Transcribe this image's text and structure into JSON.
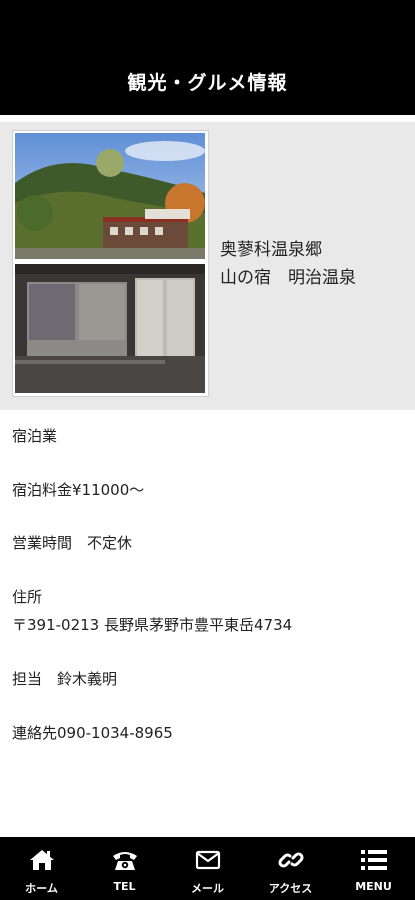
{
  "header": {
    "title": "観光・グルメ情報"
  },
  "hero": {
    "place_line1": "奥蓼科温泉郷",
    "place_line2": "山の宿　明治温泉"
  },
  "details": {
    "category": "宿泊業",
    "price": "宿泊料金¥11000〜",
    "hours": "営業時間　不定休",
    "address_label": "住所",
    "address": "〒391-0213 長野県茅野市豊平東岳4734",
    "contact_person": "担当　鈴木義明",
    "phone": "連絡先090-1034-8965"
  },
  "bottom_nav": {
    "items": [
      {
        "label": "ホーム",
        "icon": "home-icon"
      },
      {
        "label": "TEL",
        "icon": "phone-icon"
      },
      {
        "label": "メール",
        "icon": "mail-icon"
      },
      {
        "label": "アクセス",
        "icon": "link-icon"
      },
      {
        "label": "MENU",
        "icon": "menu-icon"
      }
    ]
  },
  "colors": {
    "header_bg": "#000000",
    "hero_bg": "#e9e9e9",
    "text": "#222222"
  }
}
